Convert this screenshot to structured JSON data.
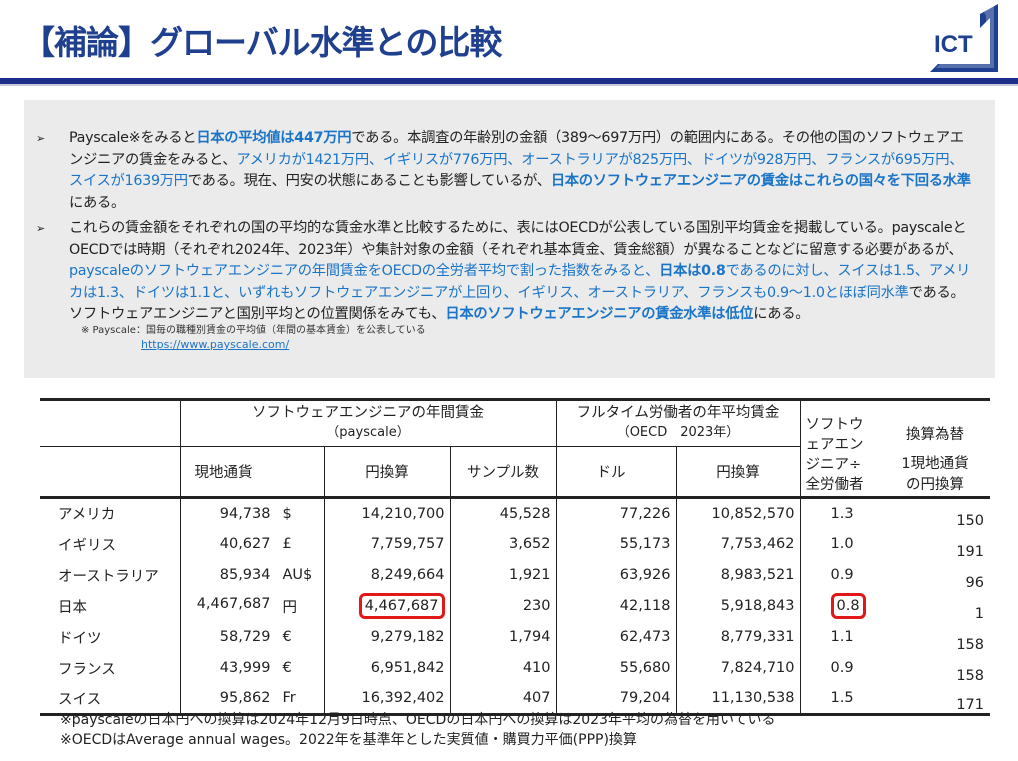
{
  "title": "【補論】グローバル水準との比較",
  "logo_text": "ICT",
  "bullets": [
    [
      [
        "n",
        "Payscale※をみると"
      ],
      [
        "b",
        "日本の平均値は447万円"
      ],
      [
        "n",
        "である。本調査の年齢別の金額（389〜697万円）の範囲内にある。その他の国のソフトウェアエンジニアの賃金をみると、"
      ],
      [
        "l",
        "アメリカが1421万円、イギリスが776万円、オーストラリアが825万円、ドイツが928万円、フランスが695万円、スイスが1639万円"
      ],
      [
        "n",
        "である。現在、円安の状態にあることも影響しているが、"
      ],
      [
        "b",
        "日本のソフトウェアエンジニアの賃金はこれらの国々を下回る水準"
      ],
      [
        "n",
        "にある。"
      ]
    ],
    [
      [
        "n",
        "これらの賃金額をそれぞれの国の平均的な賃金水準と比較するために、表にはOECDが公表している国別平均賃金を掲載している。payscaleとOECDでは時期（それぞれ2024年、2023年）や集計対象の金額（それぞれ基本賃金、賃金総額）が異なることなどに留意する必要があるが、"
      ],
      [
        "l",
        "payscaleのソフトウェアエンジニアの年間賃金をOECDの全労者平均で割った指数をみると、"
      ],
      [
        "b",
        "日本は0.8"
      ],
      [
        "l",
        "であるのに対し、スイスは1.5、アメリカは1.3、ドイツは1.1と、いずれもソフトウェアエンジニアが上回り、イギリス、オーストラリア、フランスも0.9〜1.0とほぼ同水準"
      ],
      [
        "n",
        "である。ソフトウェアエンジニアと国別平均との位置関係をみても、"
      ],
      [
        "b",
        "日本のソフトウェアエンジニアの賃金水準は低位"
      ],
      [
        "n",
        "にある。"
      ]
    ]
  ],
  "note": "※ Payscale：国毎の職種別賃金の平均値（年間の基本賃金）を公表している",
  "link": "https://www.payscale.com/",
  "table": {
    "group1": "ソフトウェアエンジニアの年間賃金",
    "group1_sub": "（payscale）",
    "group2": "フルタイム労働者の年平均賃金",
    "group2_sub": "（OECD　2023年）",
    "ratio_head": "ソフトウェアエンジニア÷全労働者",
    "rate_head1": "換算為替",
    "rate_head2": "1現地通貨の円換算",
    "cols": [
      "現地通貨",
      "円換算",
      "サンプル数",
      "ドル",
      "円換算"
    ],
    "rows": [
      {
        "country": "アメリカ",
        "local": "94,738",
        "cur": "$",
        "yen": "14,210,700",
        "sample": "45,528",
        "usd": "77,226",
        "oecd_yen": "10,852,570",
        "ratio": "1.3",
        "rate": "150"
      },
      {
        "country": "イギリス",
        "local": "40,627",
        "cur": "£",
        "yen": "7,759,757",
        "sample": "3,652",
        "usd": "55,173",
        "oecd_yen": "7,753,462",
        "ratio": "1.0",
        "rate": "191"
      },
      {
        "country": "オーストラリア",
        "local": "85,934",
        "cur": "AU$",
        "yen": "8,249,664",
        "sample": "1,921",
        "usd": "63,926",
        "oecd_yen": "8,983,521",
        "ratio": "0.9",
        "rate": "96"
      },
      {
        "country": "日本",
        "local": "4,467,687",
        "cur": "円",
        "yen": "4,467,687",
        "sample": "230",
        "usd": "42,118",
        "oecd_yen": "5,918,843",
        "ratio": "0.8",
        "rate": "1",
        "highlight": true
      },
      {
        "country": "ドイツ",
        "local": "58,729",
        "cur": "€",
        "yen": "9,279,182",
        "sample": "1,794",
        "usd": "62,473",
        "oecd_yen": "8,779,331",
        "ratio": "1.1",
        "rate": "158"
      },
      {
        "country": "フランス",
        "local": "43,999",
        "cur": "€",
        "yen": "6,951,842",
        "sample": "410",
        "usd": "55,680",
        "oecd_yen": "7,824,710",
        "ratio": "0.9",
        "rate": "158"
      },
      {
        "country": "スイス",
        "local": "95,862",
        "cur": "Fr",
        "yen": "16,392,402",
        "sample": "407",
        "usd": "79,204",
        "oecd_yen": "11,130,538",
        "ratio": "1.5",
        "rate": "171"
      }
    ]
  },
  "footnotes": [
    "※payscaleの日本円への換算は2024年12月9日時点、OECDの日本円への換算は2023年平均の為替を用いている",
    "※OECDはAverage annual wages。2022年を基準年とした実質値・購買力平価(PPP)換算"
  ],
  "colors": {
    "title": "#1f3f8f",
    "accent": "#1a74c8",
    "highlight": "#e01818"
  }
}
